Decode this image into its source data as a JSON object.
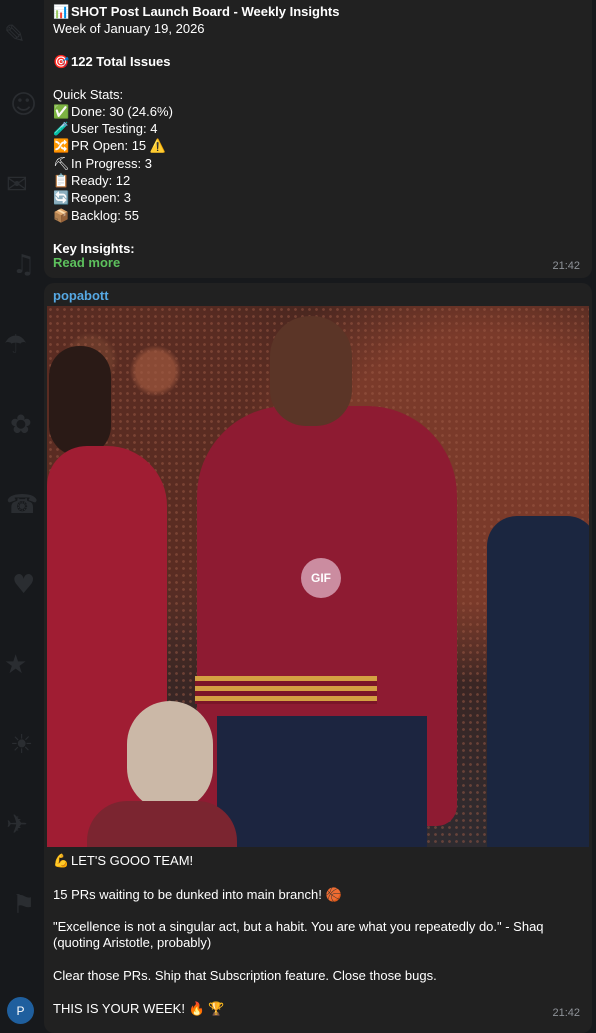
{
  "message1": {
    "lines": [
      {
        "icon": "📊",
        "text": "SHOT Post Launch Board - Weekly Insights",
        "bold": true
      },
      {
        "icon": "",
        "text": "Week of January 19, 2026",
        "bold": false
      },
      {
        "icon": "",
        "text": "",
        "bold": false
      },
      {
        "icon": "🎯",
        "text": "122 Total Issues",
        "bold": true
      },
      {
        "icon": "",
        "text": "",
        "bold": false
      },
      {
        "icon": "",
        "text": "Quick Stats:",
        "bold": false
      },
      {
        "icon": "✅",
        "text": "Done: 30 (24.6%)",
        "bold": false
      },
      {
        "icon": "🧪",
        "text": "User Testing: 4",
        "bold": false
      },
      {
        "icon": "🔀",
        "text": "PR Open: 15 ⚠️",
        "bold": false
      },
      {
        "icon": "⛏",
        "text": "In Progress: 3",
        "bold": false
      },
      {
        "icon": "📋",
        "text": "Ready: 12",
        "bold": false
      },
      {
        "icon": "🔄",
        "text": "Reopen: 3",
        "bold": false
      },
      {
        "icon": "📦",
        "text": "Backlog: 55",
        "bold": false
      },
      {
        "icon": "",
        "text": "",
        "bold": false
      },
      {
        "icon": "",
        "text": "Key Insights:",
        "bold": true
      }
    ],
    "read_more": "Read more",
    "time": "21:42"
  },
  "message2": {
    "sender": "popabott",
    "gif_label": "GIF",
    "lines": [
      {
        "icon": "💪",
        "text": "LET'S GOOO TEAM!"
      },
      {
        "icon": "",
        "text": ""
      },
      {
        "icon": "",
        "text": "15 PRs waiting to be dunked into main branch! 🏀"
      },
      {
        "icon": "",
        "text": ""
      },
      {
        "icon": "",
        "text": "\"Excellence is not a singular act, but a habit. You are what you repeatedly do.\" - Shaq (quoting Aristotle, probably)"
      },
      {
        "icon": "",
        "text": ""
      },
      {
        "icon": "",
        "text": "Clear those PRs. Ship that Subscription feature. Close those bugs."
      },
      {
        "icon": "",
        "text": ""
      },
      {
        "icon": "",
        "text": "THIS IS YOUR WEEK! 🔥 🏆"
      }
    ],
    "time": "21:42"
  },
  "avatar": {
    "initial": "P",
    "color": "#1f5f9e"
  },
  "colors": {
    "background": "#17191c",
    "bubble": "#212121",
    "link": "#5dc15d",
    "sender": "#56a8e3"
  }
}
